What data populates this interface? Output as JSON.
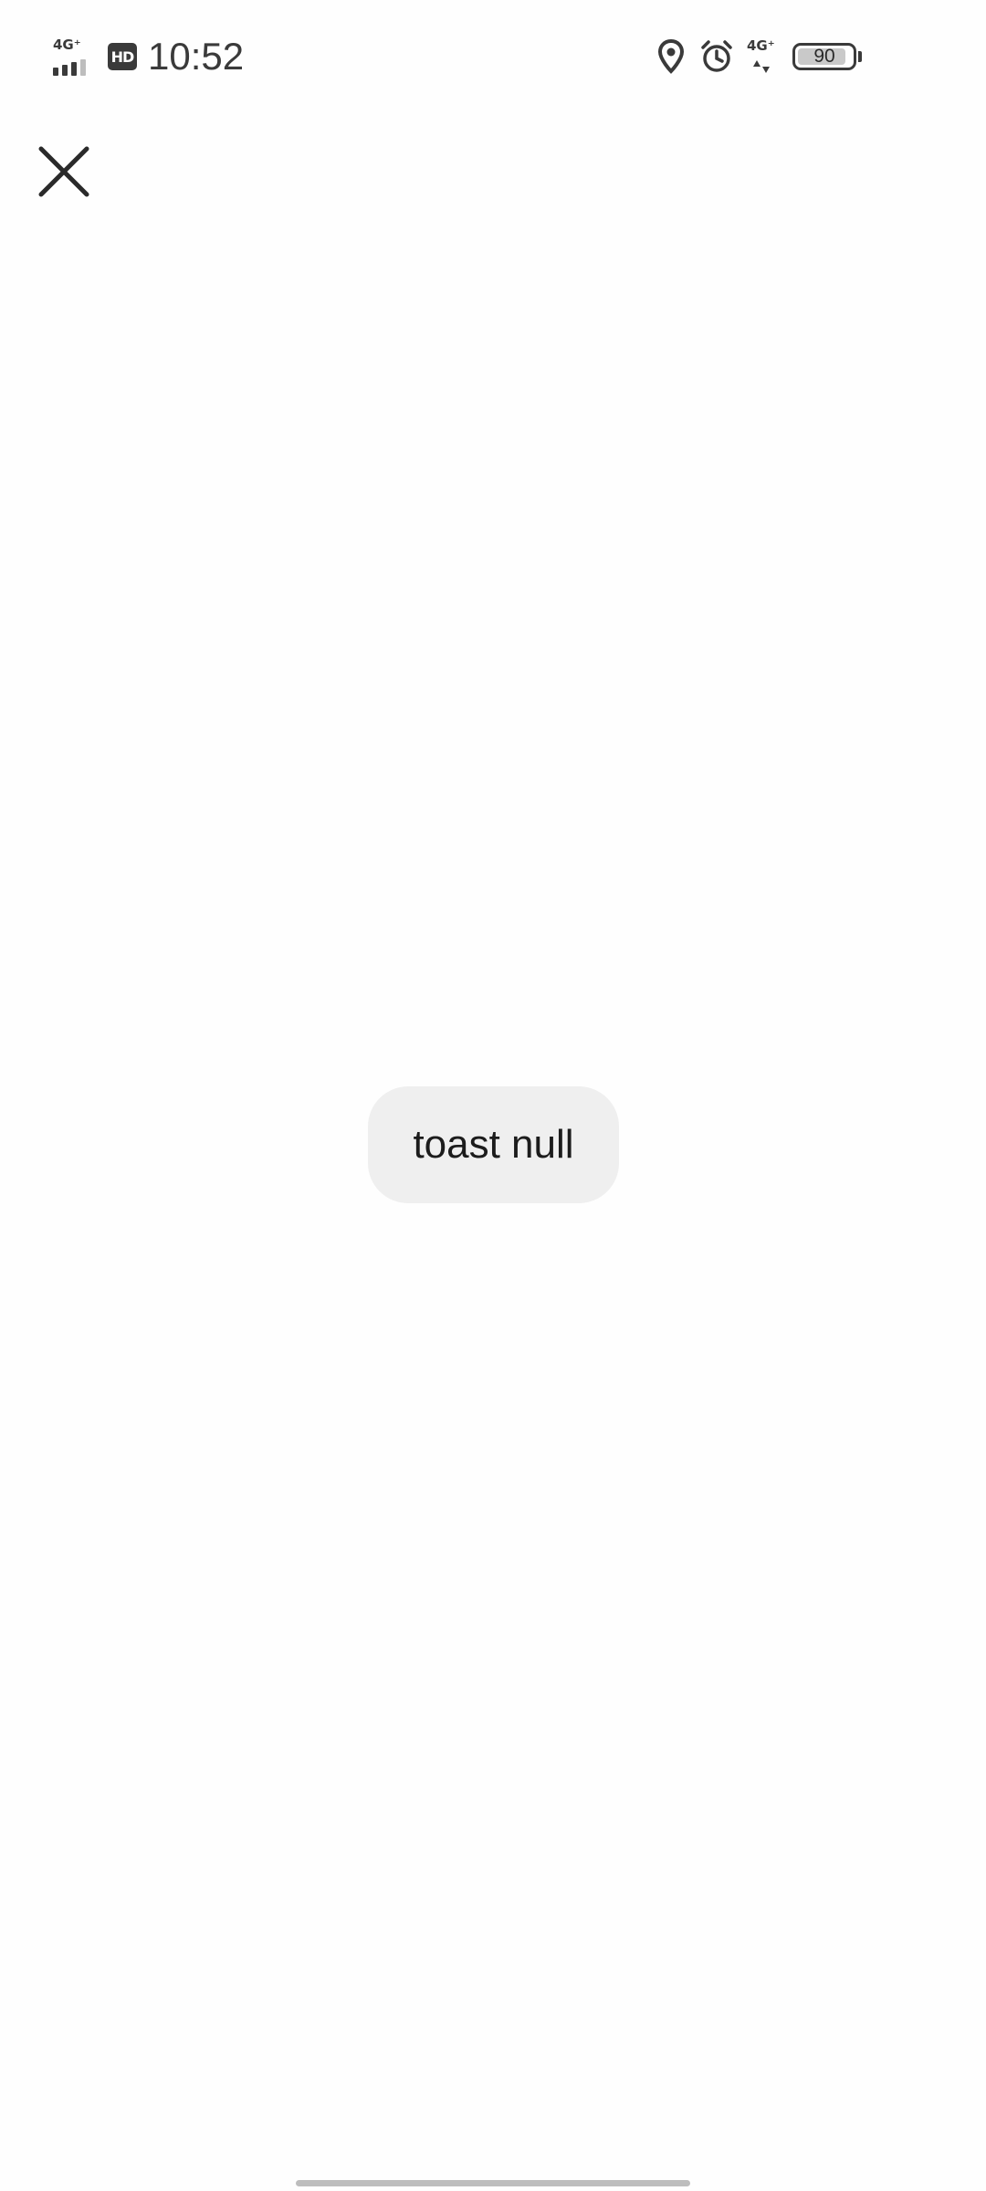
{
  "status_bar": {
    "network_left": "4G⁺",
    "hd_label": "HD",
    "time": "10:52",
    "network_right": "4G⁺",
    "battery_level": "90",
    "battery_fraction": 0.9,
    "icons": [
      "signal-icon",
      "hd-icon",
      "location-icon",
      "alarm-icon",
      "mobile-data-icon",
      "battery-icon"
    ]
  },
  "header": {
    "close_icon": "close-icon"
  },
  "toast": {
    "text": "toast null"
  },
  "colors": {
    "background": "#fefefe",
    "toast_background": "#efefef",
    "icon": "#2a2a2a",
    "home_indicator": "#bdbdbd"
  }
}
